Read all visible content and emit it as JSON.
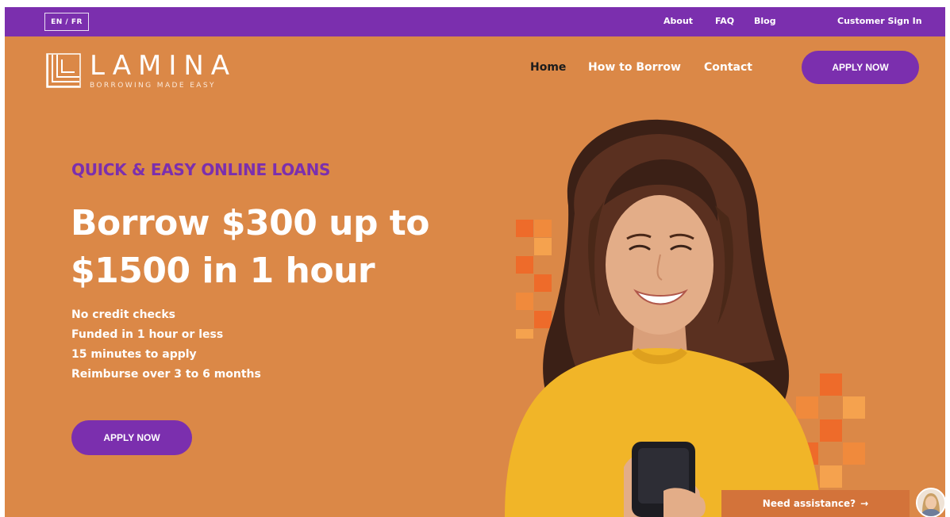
{
  "topbar": {
    "lang_toggle": "EN / FR",
    "links": {
      "about": "About",
      "faq": "FAQ",
      "blog": "Blog",
      "customer_sign_in": "Customer Sign In"
    }
  },
  "brand": {
    "name": "LAMINA",
    "tagline": "BORROWING MADE EASY"
  },
  "nav": {
    "home": "Home",
    "how_to_borrow": "How to Borrow",
    "contact": "Contact",
    "apply_now": "APPLY NOW"
  },
  "hero": {
    "eyebrow": "QUICK & EASY ONLINE LOANS",
    "headline": "Borrow $300 up to $1500 in 1 hour",
    "features": [
      "No credit checks",
      "Funded in 1 hour or less",
      "15 minutes to apply",
      "Reimburse over 3 to 6 months"
    ],
    "cta": "APPLY NOW"
  },
  "assistance": {
    "label": "Need assistance?",
    "arrow": "→"
  },
  "colors": {
    "background": "#db8847",
    "brand_purple": "#7b2fae",
    "active_nav": "#1c1c1c"
  },
  "icons": {
    "logo_mark": "stacked-l-logo-icon",
    "assist_arrow": "arrow-right-icon",
    "assist_avatar": "support-agent-avatar"
  }
}
